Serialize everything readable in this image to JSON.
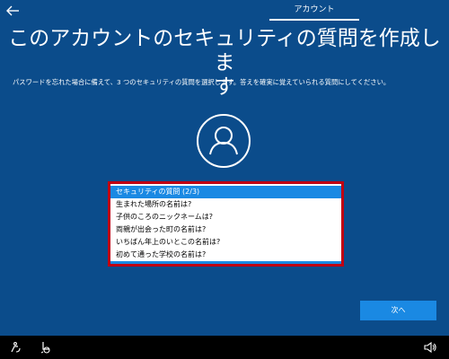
{
  "header": {
    "tab_label": "アカウント"
  },
  "main": {
    "title_line1": "このアカウントのセキュリティの質問を作成しま",
    "title_line2": "す",
    "description": "パスワードを忘れた場合に備えて、3 つのセキュリティの質問を選択します。答えを確実に覚えていられる質問にしてください。"
  },
  "security_question_dropdown": {
    "options": [
      {
        "label": "セキュリティの質問 (2/3)",
        "selected": true
      },
      {
        "label": "生まれた場所の名前は?",
        "selected": false
      },
      {
        "label": "子供のころのニックネームは?",
        "selected": false
      },
      {
        "label": "両親が出会った町の名前は?",
        "selected": false
      },
      {
        "label": "いちばん年上のいとこの名前は?",
        "selected": false
      },
      {
        "label": "初めて通った学校の名前は?",
        "selected": false
      }
    ]
  },
  "footer": {
    "next_label": "次へ"
  },
  "icons": {
    "back": "back-arrow-icon",
    "avatar": "user-avatar-icon",
    "ease_of_access": "ease-of-access-icon",
    "accessibility": "accessibility-icon",
    "volume": "volume-icon"
  },
  "colors": {
    "background": "#0b4c8b",
    "accent": "#1a89e3",
    "dropdown_border": "#c00012",
    "taskbar": "#000000"
  }
}
